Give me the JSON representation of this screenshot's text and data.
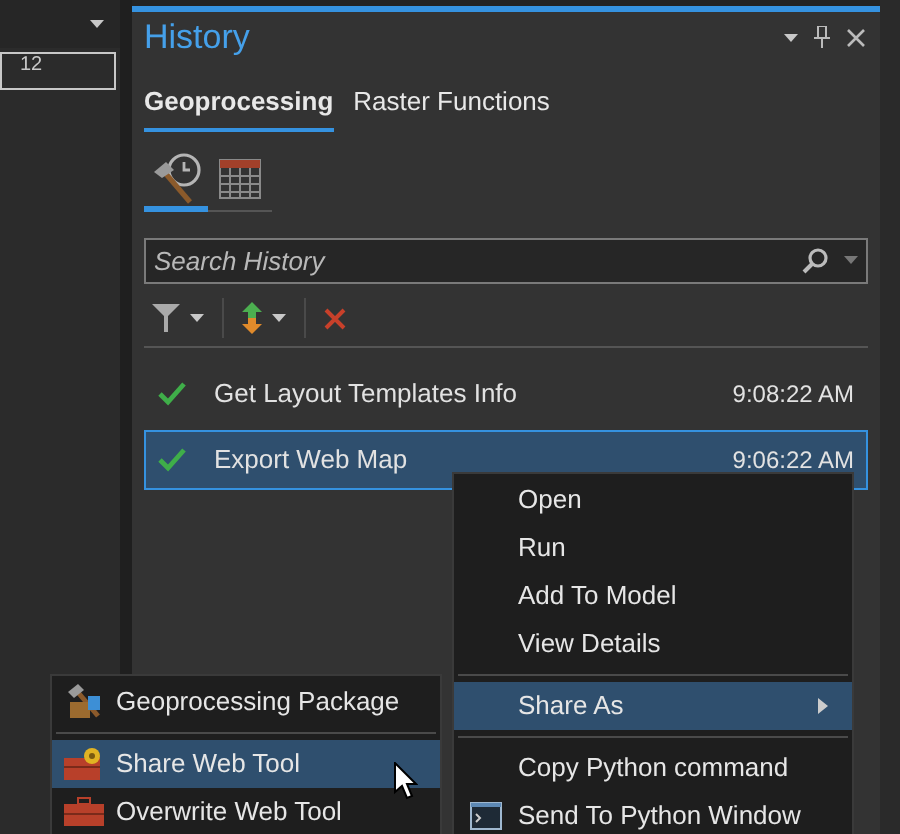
{
  "left_pane": {
    "ruler_label": "12"
  },
  "panel": {
    "title": "History",
    "tabs": [
      {
        "label": "Geoprocessing",
        "selected": true
      },
      {
        "label": "Raster Functions",
        "selected": false
      }
    ],
    "view_tabs": [
      {
        "kind": "tools",
        "selected": true
      },
      {
        "kind": "calendar",
        "selected": false
      }
    ],
    "search": {
      "placeholder": "Search History"
    },
    "rows": [
      {
        "name": "Get Layout Templates Info",
        "time": "9:08:22 AM",
        "kind": "success",
        "selected": false
      },
      {
        "name": "Export Web Map",
        "time": "9:06:22 AM",
        "kind": "success",
        "selected": true
      }
    ]
  },
  "context_menu": {
    "groups": [
      [
        {
          "label": "Open",
          "kind": "item",
          "selected": false
        },
        {
          "label": "Run",
          "kind": "item",
          "selected": false
        },
        {
          "label": "Add To Model",
          "kind": "item",
          "selected": false
        },
        {
          "label": "View Details",
          "kind": "item",
          "selected": false
        }
      ],
      [
        {
          "label": "Share As",
          "kind": "submenu",
          "selected": true
        }
      ],
      [
        {
          "label": "Copy Python command",
          "kind": "item",
          "selected": false
        },
        {
          "label": "Send To Python Window",
          "kind": "console",
          "selected": false
        }
      ]
    ]
  },
  "submenu": {
    "groups": [
      [
        {
          "label": "Geoprocessing Package",
          "kind": "package",
          "selected": false
        }
      ],
      [
        {
          "label": "Share Web Tool",
          "kind": "share",
          "selected": true
        },
        {
          "label": "Overwrite Web Tool",
          "kind": "overwrite",
          "selected": false
        }
      ]
    ]
  }
}
